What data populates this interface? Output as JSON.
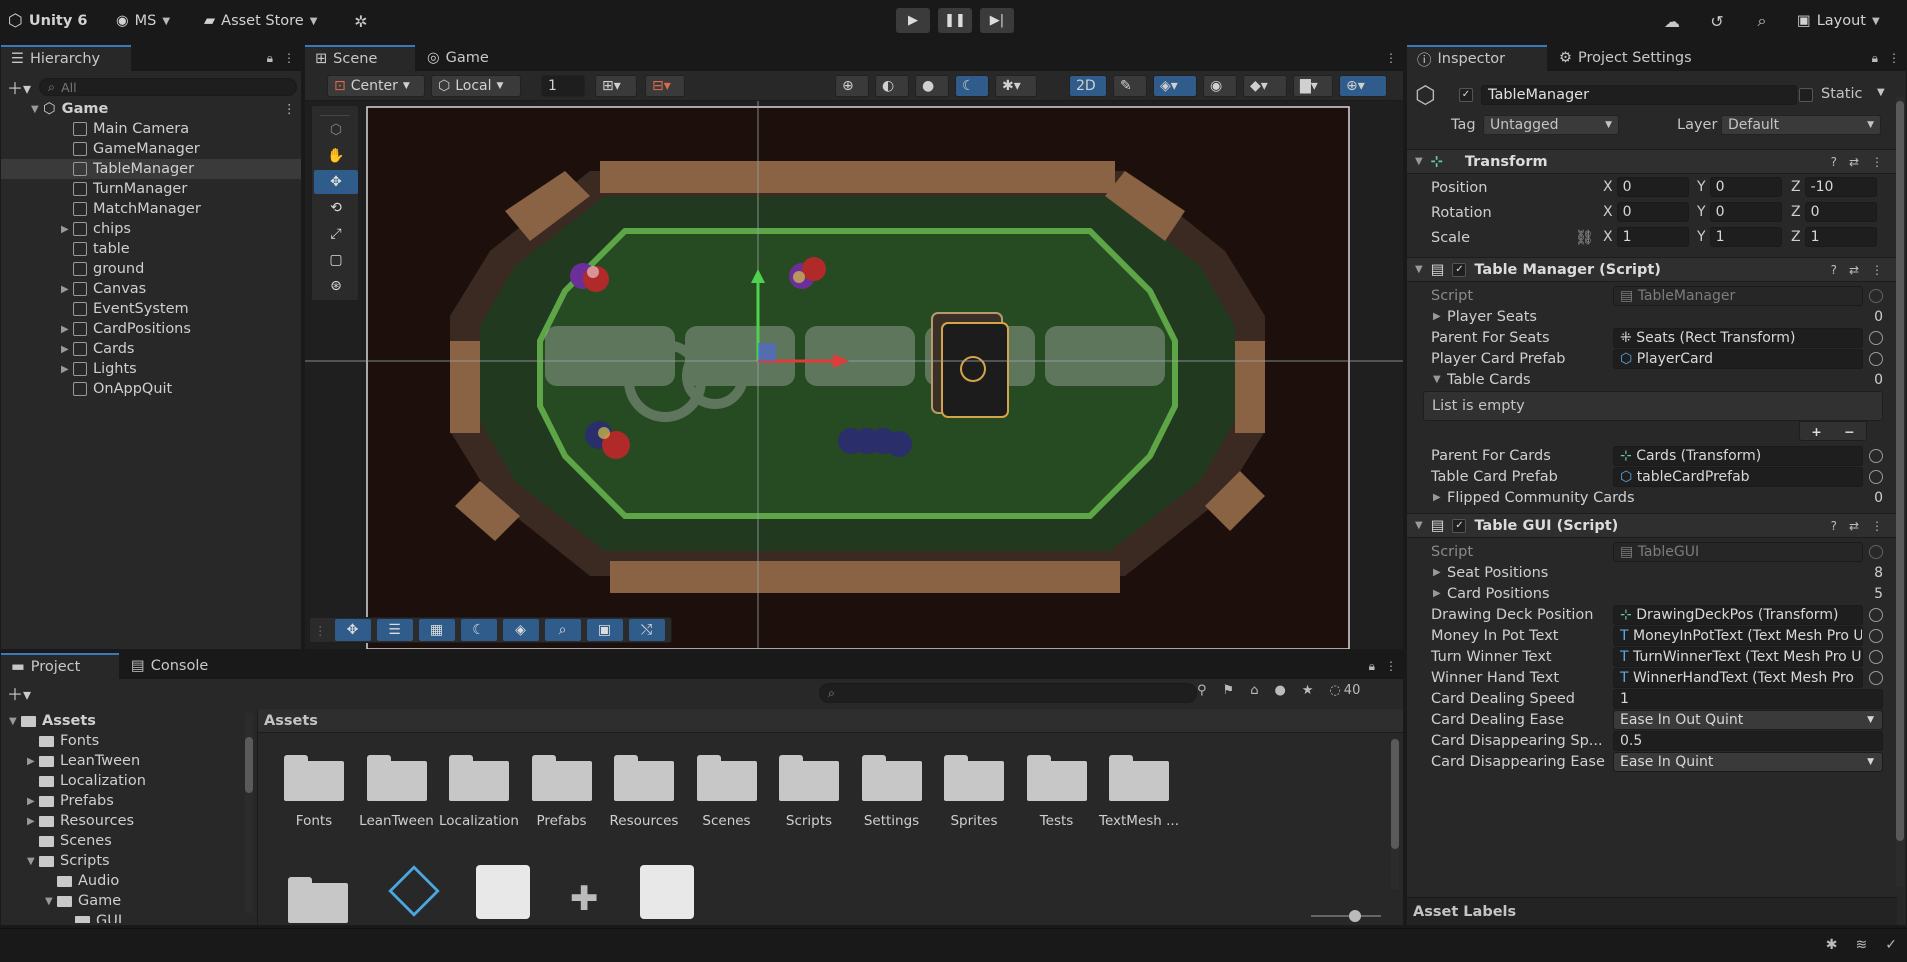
{
  "topbar": {
    "app_name": "Unity 6",
    "account": "MS",
    "asset_store": "Asset Store",
    "layout": "Layout"
  },
  "hierarchy": {
    "tab": "Hierarchy",
    "search_placeholder": "All",
    "scene": "Game",
    "items": [
      {
        "label": "Main Camera",
        "expandable": false
      },
      {
        "label": "GameManager",
        "expandable": false
      },
      {
        "label": "TableManager",
        "expandable": false,
        "selected": true
      },
      {
        "label": "TurnManager",
        "expandable": false
      },
      {
        "label": "MatchManager",
        "expandable": false
      },
      {
        "label": "chips",
        "expandable": true
      },
      {
        "label": "table",
        "expandable": false
      },
      {
        "label": "ground",
        "expandable": false
      },
      {
        "label": "Canvas",
        "expandable": true
      },
      {
        "label": "EventSystem",
        "expandable": false
      },
      {
        "label": "CardPositions",
        "expandable": true
      },
      {
        "label": "Cards",
        "expandable": true
      },
      {
        "label": "Lights",
        "expandable": true
      },
      {
        "label": "OnAppQuit",
        "expandable": false
      }
    ]
  },
  "scene": {
    "tabs": [
      "Scene",
      "Game"
    ],
    "pivot": "Center",
    "space": "Local",
    "grid_value": "1",
    "mode_2d": "2D"
  },
  "inspector": {
    "tabs": [
      "Inspector",
      "Project Settings"
    ],
    "object_name": "TableManager",
    "static_label": "Static",
    "tag_label": "Tag",
    "tag_value": "Untagged",
    "layer_label": "Layer",
    "layer_value": "Default",
    "transform": {
      "title": "Transform",
      "position_label": "Position",
      "position": [
        "0",
        "0",
        "-10"
      ],
      "rotation_label": "Rotation",
      "rotation": [
        "0",
        "0",
        "0"
      ],
      "scale_label": "Scale",
      "scale": [
        "1",
        "1",
        "1"
      ],
      "axes": [
        "X",
        "Y",
        "Z"
      ]
    },
    "table_manager": {
      "title": "Table Manager (Script)",
      "script_label": "Script",
      "script_value": "TableManager",
      "player_seats_label": "Player Seats",
      "player_seats_count": "0",
      "parent_for_seats_label": "Parent For Seats",
      "parent_for_seats_value": "Seats (Rect Transform)",
      "player_card_prefab_label": "Player Card Prefab",
      "player_card_prefab_value": "PlayerCard",
      "table_cards_label": "Table Cards",
      "table_cards_count": "0",
      "list_empty": "List is empty",
      "parent_for_cards_label": "Parent For Cards",
      "parent_for_cards_value": "Cards (Transform)",
      "table_card_prefab_label": "Table Card Prefab",
      "table_card_prefab_value": "tableCardPrefab",
      "flipped_label": "Flipped Community Cards",
      "flipped_count": "0"
    },
    "table_gui": {
      "title": "Table GUI (Script)",
      "script_label": "Script",
      "script_value": "TableGUI",
      "seat_positions_label": "Seat Positions",
      "seat_positions_count": "8",
      "card_positions_label": "Card Positions",
      "card_positions_count": "5",
      "drawing_deck_label": "Drawing Deck Position",
      "drawing_deck_value": "DrawingDeckPos (Transform)",
      "money_label": "Money In Pot Text",
      "money_value": "MoneyInPotText (Text Mesh Pro U",
      "turn_winner_label": "Turn Winner Text",
      "turn_winner_value": "TurnWinnerText (Text Mesh Pro U",
      "winner_hand_label": "Winner Hand Text",
      "winner_hand_value": "WinnerHandText (Text Mesh Pro",
      "dealing_speed_label": "Card Dealing Speed",
      "dealing_speed_value": "1",
      "dealing_ease_label": "Card Dealing Ease",
      "dealing_ease_value": "Ease In Out Quint",
      "disappear_speed_label": "Card Disappearing Sp...",
      "disappear_speed_value": "0.5",
      "disappear_ease_label": "Card Disappearing Ease",
      "disappear_ease_value": "Ease In Quint"
    },
    "asset_labels": "Asset Labels"
  },
  "project": {
    "tabs": [
      "Project",
      "Console"
    ],
    "hidden_count": "40",
    "breadcrumb": "Assets",
    "tree": [
      {
        "label": "Assets",
        "depth": 0,
        "expanded": true
      },
      {
        "label": "Fonts",
        "depth": 1
      },
      {
        "label": "LeanTween",
        "depth": 1,
        "expandable": true
      },
      {
        "label": "Localization",
        "depth": 1
      },
      {
        "label": "Prefabs",
        "depth": 1,
        "expandable": true
      },
      {
        "label": "Resources",
        "depth": 1,
        "expandable": true
      },
      {
        "label": "Scenes",
        "depth": 1
      },
      {
        "label": "Scripts",
        "depth": 1,
        "expanded": true
      },
      {
        "label": "Audio",
        "depth": 2
      },
      {
        "label": "Game",
        "depth": 2,
        "expanded": true
      },
      {
        "label": "GUI",
        "depth": 3
      }
    ],
    "assets": [
      "Fonts",
      "LeanTween",
      "Localization",
      "Prefabs",
      "Resources",
      "Scenes",
      "Scripts",
      "Settings",
      "Sprites",
      "Tests",
      "TextMesh ..."
    ]
  }
}
